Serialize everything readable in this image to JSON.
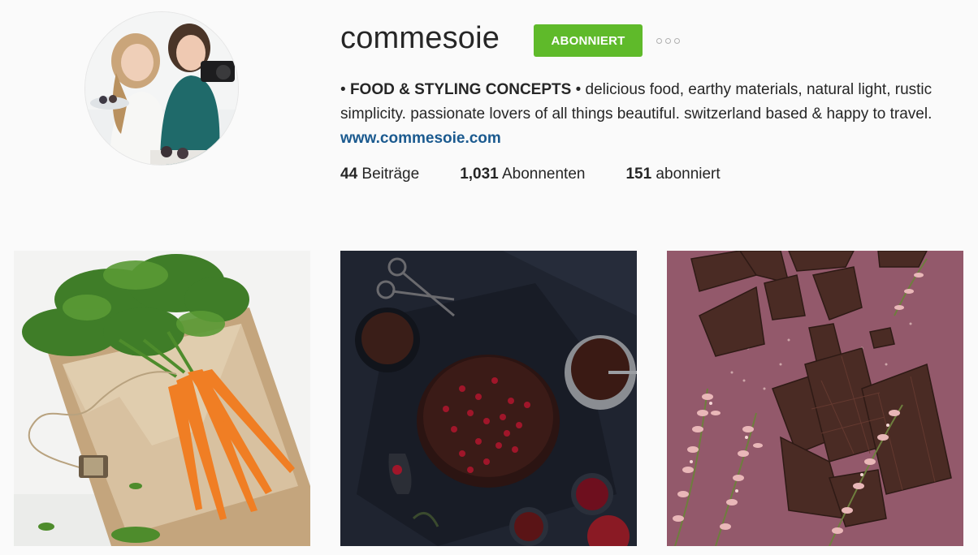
{
  "profile": {
    "username": "commesoie",
    "follow_label": "ABONNIERT",
    "more_icon": "ellipsis-icon",
    "bio": {
      "bullet_start": "• ",
      "title": "FOOD & STYLING CONCEPTS",
      "text": " • delicious food, earthy materials, natural light, rustic simplicity. passionate lovers of all things beautiful. switzerland based & happy to travel. ",
      "link": "www.commesoie.com"
    },
    "stats": [
      {
        "num": "44",
        "label": " Beiträge"
      },
      {
        "num": "1,031",
        "label": " Abonnenten"
      },
      {
        "num": "151",
        "label": " abonniert"
      }
    ],
    "colors": {
      "follow_button": "#5fba2a",
      "link": "#1b5a8f"
    }
  },
  "posts": [
    {
      "subject": "carrots-photo"
    },
    {
      "subject": "chocolate-cake-photo"
    },
    {
      "subject": "chocolate-bars-photo"
    }
  ]
}
